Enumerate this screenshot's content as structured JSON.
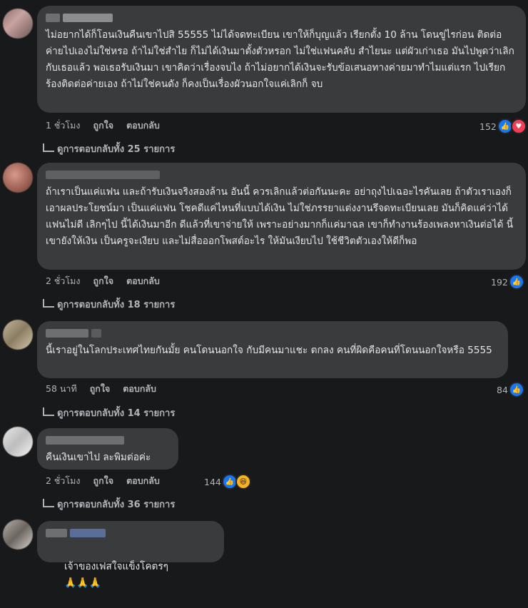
{
  "comments": [
    {
      "text": "ไม่อยากได้ก็โอนเงินคืนเขาไปสิ 55555 ไม่ได้จดทะเบียน เขาให้ก็บุญแล้ว เรียกตั้ง 10 ล้าน โดนขู่ไรก่อน ติดต่อค่ายไปเองไม่ใช่หรอ ถ้าไม่ใช่สำไย ก็ไม่ได้เงินมาตั้งตัวหรอก ไม่ใช่แฟนคลับ สำไยนะ แต่ผัวเก่าเธอ มันไปพูดว่าเลิกกับเธอแล้ว พอเธอรับเงินมา เขาคิดว่าเรื่องจบไง ถ้าไม่อยากได้เงินจะรับข้อเสนอทางค่ายมาทำไมแต่แรก ไปเรียกร้องติดต่อค่ายเอง ถ้าไม่ใช่คนดัง ก็คงเป็นเรื่องผัวนอกใจแค่เลิกก็ จบ",
      "time": "1 ชั่วโมง",
      "like": "ถูกใจ",
      "reply": "ตอบกลับ",
      "count": "152",
      "replies": "ดูการตอบกลับทั้ง 25 รายการ"
    },
    {
      "text": "ถ้าเราเป็นแค่แฟน และถ้ารับเงินจริงสองล้าน อันนี้ ควรเลิกแล้วต่อกันนะคะ อย่าถุงไปเฉอะไรคันเลย ถ้าตัวเราเองก็เอาผลประโยชน์มา เป็นแค่แฟน โชคดีแค่ไหนที่แบบได้เงิน ไม่ใช่ภรรยาแต่งงานรึจดทะเบียนเลย มันก็คิดแค่ว่าได้แฟนไม่ดี เลิกๆไป นี้ได้เงินมาอีก ดีแล้วที่เขาจ่ายให้ เพราะอย่างมากก็แค่มาฉล เขาก็ทำงานร้องเพลงหาเงินต่อได้ นี้เขายังให้เงิน เป็นครูจะเงียบ และไม่สื่อออกโพสต์อะไร ให้มันเงียบไป ใช้ชีวิตตัวเองให้ดีก็พอ",
      "time": "2 ชั่วโมง",
      "like": "ถูกใจ",
      "reply": "ตอบกลับ",
      "count": "192",
      "replies": "ดูการตอบกลับทั้ง 18 รายการ"
    },
    {
      "text": "นี้เราอยู่ในโลกประเทศไทยกันมั้ย คนโดนนอกใจ กับมีคนมาแชะ ตกลง คนที่ผิดคือคนที่โดนนอกใจหรือ 5555",
      "time": "58 นาที",
      "like": "ถูกใจ",
      "reply": "ตอบกลับ",
      "count": "84",
      "replies": "ดูการตอบกลับทั้ง 14 รายการ"
    },
    {
      "text": "คืนเงินเขาไป ละพิมต่อค่ะ",
      "time": "2 ชั่วโมง",
      "like": "ถูกใจ",
      "reply": "ตอบกลับ",
      "count": "144",
      "replies": "ดูการตอบกลับทั้ง 36 รายการ"
    },
    {
      "text": "เจ้าของเฟสใจแข็งโคตรๆ",
      "emoji": "🙏🙏🙏"
    }
  ]
}
